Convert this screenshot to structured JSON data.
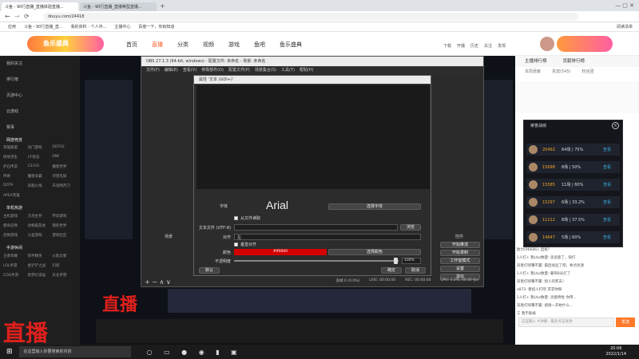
{
  "browser": {
    "tab1": "斗鱼 - 90行直播_直播体验直播...",
    "tab2": "斗鱼 - 90行直播_直播等型直播...",
    "url": "douyu.com/24418",
    "bookmarks": [
      "应用",
      "斗鱼 - 90行直播_直...",
      "我的资料 - 个人中...",
      "主播中心",
      "百度一下，你就知道"
    ],
    "bm_right": "阅读清单"
  },
  "douyu": {
    "nav": [
      "首页",
      "直播",
      "分类",
      "视频",
      "游戏",
      "鱼吧",
      "鱼乐盛典"
    ],
    "top_icons": [
      "下载",
      "开播",
      "历史",
      "关注",
      "人",
      "发现"
    ],
    "brand": "鱼乐盛典"
  },
  "left_nav": {
    "items": [
      "我的关注",
      "排行榜",
      "页游中心",
      "云游戏",
      "赛事"
    ],
    "section1": "网游竞技",
    "games1": [
      "英雄联盟",
      "热门游戏",
      "DOTA2",
      "绝地求生",
      "CF射击",
      "DNF",
      "炉石传说",
      "CS:GO",
      "魔兽世界",
      "传奇",
      "魔兽争霸",
      "守望先锋",
      "DOTA",
      "穿越火线",
      "天涯明月刀",
      "APEX英雄"
    ],
    "section2": "单机热游",
    "games2": [
      "主机游戏",
      "方舟生存",
      "怀旧游戏",
      "使命召唤",
      "动物森友会",
      "我的世界",
      "恐怖游戏",
      "沙盒游戏",
      "游戏社区"
    ],
    "section3": "手游休闲",
    "games3": [
      "王者荣耀",
      "和平精英",
      "火影忍者",
      "LOL手游",
      "金铲铲之战",
      "幻塔",
      "COD手游",
      "新梦幻诛仙",
      "天龙手游"
    ]
  },
  "obs": {
    "title": "OBS 27.1.3 (64-bit, windows) - 配置文件: 未命名 - 场景: 未命名",
    "menu": [
      "文件(F)",
      "编辑(E)",
      "查看(V)",
      "停靠部件(D)",
      "配置文件(P)",
      "场景集合(S)",
      "工具(T)",
      "帮助(H)"
    ],
    "scenes": "场景",
    "controls": "控件",
    "ctrl_buttons": [
      "开始推流",
      "开始录制",
      "工作室模式",
      "设置",
      "退出"
    ],
    "status": [
      "丢帧 0 (0.0%)",
      "LIVE: 00:00:00",
      "REC: 00:00:00",
      "CPU: 1.3%, 60.00 fps"
    ]
  },
  "dialog": {
    "title": "属性 '文本 (GDI+)'",
    "font_label": "字体",
    "font_name": "Arial",
    "font_button": "选择字体",
    "text_from_file": "从文件读取",
    "text_label": "文本文件 (UTF-8)",
    "browse": "浏览",
    "align_label": "对齐",
    "align_value": "左",
    "vertical_label": "垂直对齐",
    "color_label": "颜色",
    "color_hex": "#ff0000",
    "color_button": "选择颜色",
    "opacity_label": "不透明度",
    "opacity_value": "100%",
    "defaults": "默认",
    "ok": "确定",
    "cancel": "取消"
  },
  "stream": {
    "big_text": "直播",
    "bottom_text": "直播"
  },
  "right": {
    "tabs": [
      "主播排行榜",
      "贡献排行榜"
    ],
    "sub_tabs": [
      "本周贡献",
      "贵宾(545)",
      "粉丝团"
    ],
    "rank_title": "荣誉战绩",
    "rankings": [
      {
        "score": "20492",
        "record": "64场 | 75%",
        "btn": "查看"
      },
      {
        "score": "15698",
        "record": "8场 | 50%",
        "btn": "查看"
      },
      {
        "score": "15585",
        "record": "11场 | 60%",
        "btn": "查看"
      },
      {
        "score": "15297",
        "record": "6场 | 33.2%",
        "btn": "查看"
      },
      {
        "score": "11112",
        "record": "8场 | 37.5%",
        "btn": "查看"
      },
      {
        "score": "14647",
        "record": "5场 | 60%",
        "btn": "查看"
      }
    ],
    "chat": [
      "欧力(96686): 直接?",
      "1人打+ 我Uos数量: 谈谈意了，快打",
      "双爸打喷嚏不赢: 最后加豆了吧，希点优清",
      "1人打+ 我Uos数量: 葡萄8光灯了",
      "双爸打喷嚏不赢: 别人的死去！",
      "e872: 看招人打吧 求求你啊",
      "1人打+ 我Uos数量: 灵能特性 你用...",
      "双爸打喷嚏不赢: 感谢一开始什么..."
    ],
    "chat_bottom": "工 我不能被",
    "input_placeholder": "这里输入 #弹幕 · 最多点击发弹",
    "send": "发送"
  },
  "taskbar": {
    "search": "在这里输入你要搜索的内容",
    "time": "20:06",
    "date": "2022/1/14"
  }
}
